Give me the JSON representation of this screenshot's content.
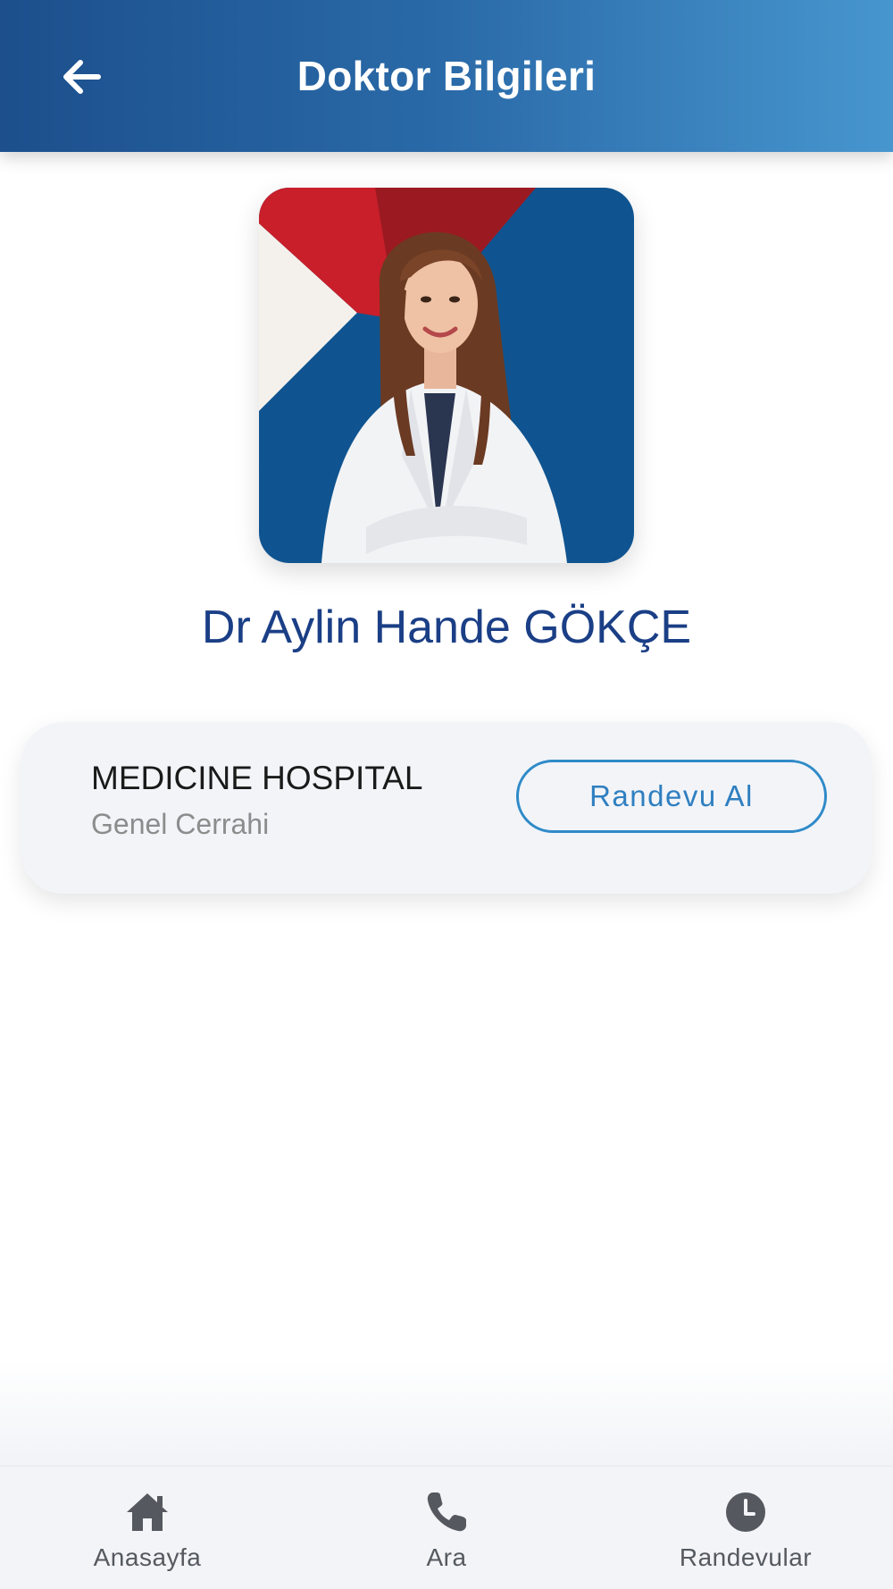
{
  "header": {
    "title": "Doktor Bilgileri",
    "back_icon": "arrow-left-icon"
  },
  "doctor": {
    "name": "Dr Aylin Hande GÖKÇE",
    "photo": "doctor-photo"
  },
  "card": {
    "hospital": "MEDICINE HOSPITAL",
    "department": "Genel Cerrahi",
    "button_label": "Randevu Al"
  },
  "tabbar": {
    "items": [
      {
        "label": "Anasayfa",
        "icon": "home-icon"
      },
      {
        "label": "Ara",
        "icon": "phone-icon"
      },
      {
        "label": "Randevular",
        "icon": "clock-icon"
      }
    ]
  },
  "colors": {
    "header_start": "#1c4f8c",
    "header_end": "#4796cf",
    "name": "#1b3f86",
    "accent": "#2f8ac8",
    "card_bg": "#f2f4f8"
  }
}
